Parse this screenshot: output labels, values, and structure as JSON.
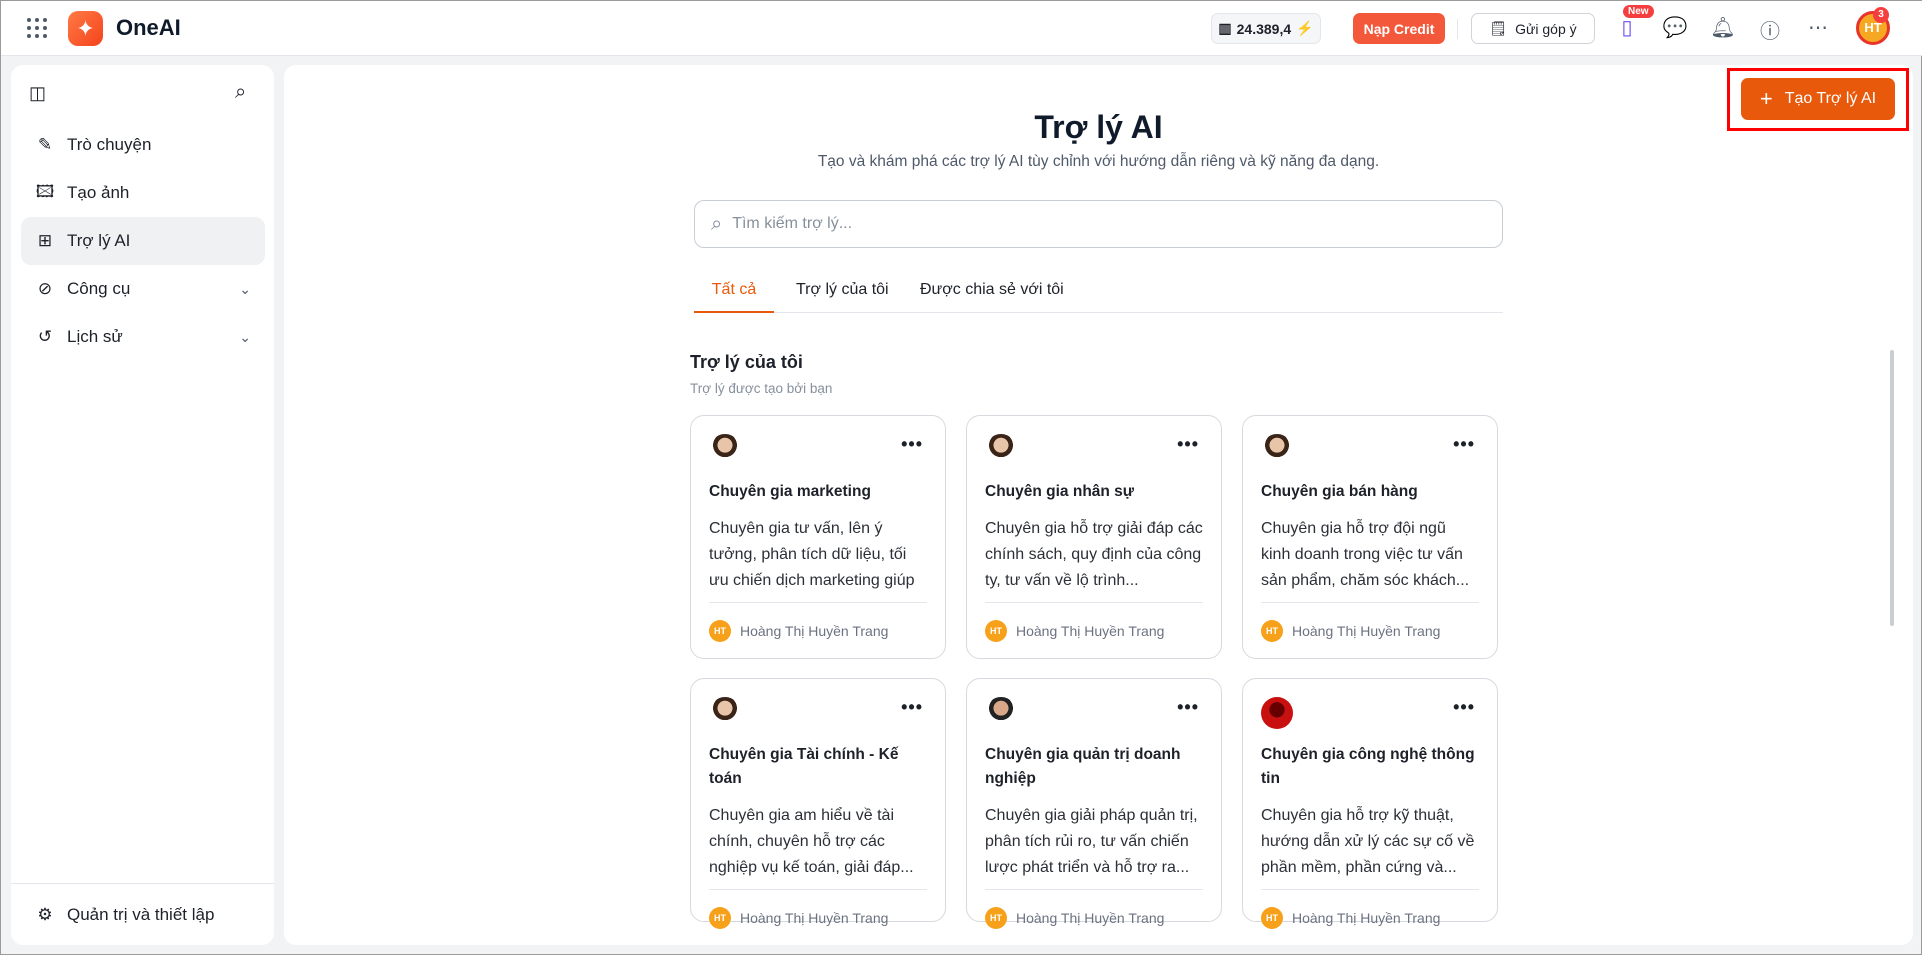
{
  "app": {
    "name": "OneAI"
  },
  "header": {
    "credits": "24.389,4",
    "topup_label": "Nạp Credit",
    "feedback_label": "Gửi góp ý",
    "new_badge": "New",
    "avatar_initials": "HT",
    "notification_count": "3"
  },
  "sidebar": {
    "items": [
      {
        "label": "Trò chuyện",
        "icon": "edit-icon"
      },
      {
        "label": "Tạo ảnh",
        "icon": "image-plus-icon"
      },
      {
        "label": "Trợ lý AI",
        "icon": "grid-icon",
        "active": true
      },
      {
        "label": "Công cụ",
        "icon": "compass-icon"
      },
      {
        "label": "Lịch sử",
        "icon": "history-icon"
      }
    ],
    "settings_label": "Quản trị và thiết lập"
  },
  "main": {
    "title": "Trợ lý AI",
    "subtitle": "Tạo và khám phá các trợ lý AI tùy chỉnh với hướng dẫn riêng và kỹ năng đa dạng.",
    "create_label": "Tạo Trợ lý AI",
    "search_placeholder": "Tìm kiếm trợ lý...",
    "tabs": [
      {
        "label": "Tất cả"
      },
      {
        "label": "Trợ lý của tôi"
      },
      {
        "label": "Được chia sẻ với tôi"
      }
    ],
    "section_title": "Trợ lý của tôi",
    "section_subtitle": "Trợ lý được tạo bởi bạn",
    "cards": [
      {
        "title": "Chuyên gia marketing",
        "desc": "Chuyên gia tư vấn, lên ý tưởng, phân tích dữ liệu, tối ưu chiến dịch marketing giúp ti...",
        "author": "Hoàng Thị Huyền Trang",
        "initials": "HT"
      },
      {
        "title": "Chuyên gia nhân sự",
        "desc": "Chuyên gia hỗ trợ giải đáp các chính sách, quy định của công ty, tư vấn về lộ trình...",
        "author": "Hoàng Thị Huyền Trang",
        "initials": "HT"
      },
      {
        "title": "Chuyên gia bán hàng",
        "desc": "Chuyên gia hỗ trợ đội ngũ kinh doanh trong việc tư vấn sản phẩm, chăm sóc khách...",
        "author": "Hoàng Thị Huyền Trang",
        "initials": "HT"
      },
      {
        "title": "Chuyên gia Tài chính - Kế toán",
        "desc": "Chuyên gia am hiểu về tài chính, chuyên hỗ trợ các nghiệp vụ kế toán, giải đáp...",
        "author": "Hoàng Thị Huyền Trang",
        "initials": "HT"
      },
      {
        "title": "Chuyên gia quản trị doanh nghiệp",
        "desc": "Chuyên gia giải pháp quản trị, phân tích rủi ro, tư vấn chiến lược phát triển và hỗ trợ ra...",
        "author": "Hoàng Thị Huyền Trang",
        "initials": "HT"
      },
      {
        "title": "Chuyên gia công nghệ thông tin",
        "desc": "Chuyên gia hỗ trợ kỹ thuật, hướng dẫn xử lý các sự cố về phần mềm, phần cứng và...",
        "author": "Hoàng Thị Huyền Trang",
        "initials": "HT"
      }
    ]
  }
}
